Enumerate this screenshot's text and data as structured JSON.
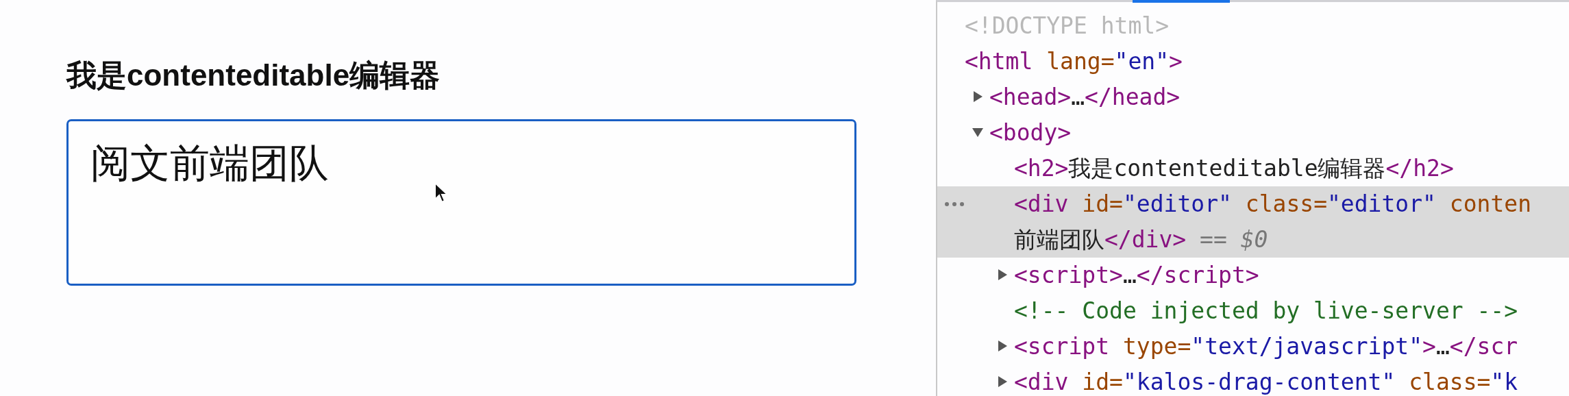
{
  "page": {
    "heading": "我是contenteditable编辑器",
    "editor": {
      "value": "阅文前端团队"
    }
  },
  "devtools": {
    "nodes": [
      {
        "selected": false,
        "lines": [
          [
            {
              "kind": "doctype",
              "text": "<!DOCTYPE html>"
            }
          ]
        ]
      },
      {
        "selected": false,
        "lines": [
          [
            {
              "kind": "tag",
              "text": "<html"
            },
            {
              "kind": "attr",
              "text": " lang="
            },
            {
              "kind": "value",
              "text": "\"en\""
            },
            {
              "kind": "tag",
              "text": ">"
            }
          ]
        ],
        "children": [
          {
            "expanded": false,
            "selected": false,
            "lines": [
              [
                {
                  "kind": "tag",
                  "text": "<head>"
                },
                {
                  "kind": "text",
                  "text": "…"
                },
                {
                  "kind": "tag",
                  "text": "</head>"
                }
              ]
            ]
          },
          {
            "expanded": true,
            "selected": false,
            "lines": [
              [
                {
                  "kind": "tag",
                  "text": "<body>"
                }
              ]
            ],
            "children": [
              {
                "selected": false,
                "lines": [
                  [
                    {
                      "kind": "tag",
                      "text": "<h2>"
                    },
                    {
                      "kind": "text",
                      "text": "我是contenteditable编辑器"
                    },
                    {
                      "kind": "tag",
                      "text": "</h2>"
                    }
                  ]
                ]
              },
              {
                "selected": true,
                "lines": [
                  [
                    {
                      "kind": "tag",
                      "text": "<div"
                    },
                    {
                      "kind": "attr",
                      "text": " id="
                    },
                    {
                      "kind": "value",
                      "text": "\"editor\""
                    },
                    {
                      "kind": "attr",
                      "text": " class="
                    },
                    {
                      "kind": "value",
                      "text": "\"editor\""
                    },
                    {
                      "kind": "attr",
                      "text": " conten"
                    }
                  ],
                  [
                    {
                      "kind": "text",
                      "text": "前端团队"
                    },
                    {
                      "kind": "tag",
                      "text": "</div>"
                    },
                    {
                      "kind": "marker",
                      "text": " == "
                    },
                    {
                      "kind": "ref",
                      "text": "$0"
                    }
                  ]
                ]
              },
              {
                "expanded": false,
                "selected": false,
                "lines": [
                  [
                    {
                      "kind": "tag",
                      "text": "<script>"
                    },
                    {
                      "kind": "text",
                      "text": "…"
                    },
                    {
                      "kind": "tag",
                      "text": "</script>"
                    }
                  ]
                ]
              },
              {
                "selected": false,
                "lines": [
                  [
                    {
                      "kind": "comment",
                      "text": "<!-- Code injected by live-server -->"
                    }
                  ]
                ]
              },
              {
                "expanded": false,
                "selected": false,
                "lines": [
                  [
                    {
                      "kind": "tag",
                      "text": "<script"
                    },
                    {
                      "kind": "attr",
                      "text": " type="
                    },
                    {
                      "kind": "value",
                      "text": "\"text/javascript\""
                    },
                    {
                      "kind": "tag",
                      "text": ">"
                    },
                    {
                      "kind": "text",
                      "text": "…"
                    },
                    {
                      "kind": "tag",
                      "text": "</scr"
                    }
                  ]
                ]
              },
              {
                "expanded": false,
                "selected": false,
                "lines": [
                  [
                    {
                      "kind": "tag",
                      "text": "<div"
                    },
                    {
                      "kind": "attr",
                      "text": " id="
                    },
                    {
                      "kind": "value",
                      "text": "\"kalos-drag-content\""
                    },
                    {
                      "kind": "attr",
                      "text": " class="
                    },
                    {
                      "kind": "value",
                      "text": "\"k"
                    }
                  ]
                ]
              }
            ]
          }
        ]
      }
    ]
  }
}
